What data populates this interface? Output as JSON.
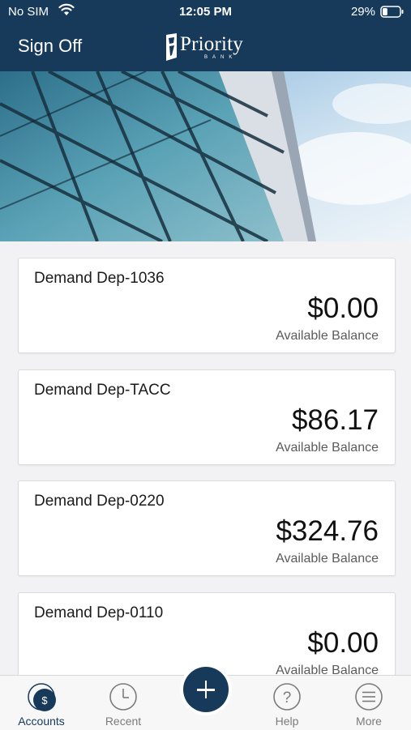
{
  "status_bar": {
    "carrier": "No SIM",
    "time": "12:05 PM",
    "battery_percent": "29%",
    "battery_level": 0.29
  },
  "header": {
    "sign_off_label": "Sign Off",
    "brand_name": "Priority",
    "brand_sub": "BANK",
    "background_color": "#173a5a"
  },
  "accounts": [
    {
      "name": "Demand Dep-1036",
      "balance": "$0.00",
      "balance_label": "Available Balance"
    },
    {
      "name": "Demand Dep-TACC",
      "balance": "$86.17",
      "balance_label": "Available Balance"
    },
    {
      "name": "Demand Dep-0220",
      "balance": "$324.76",
      "balance_label": "Available Balance"
    },
    {
      "name": "Demand Dep-0110",
      "balance": "$0.00",
      "balance_label": "Available Balance"
    }
  ],
  "tab_bar": {
    "accounts": {
      "label": "Accounts",
      "icon": "dollar-circle-icon",
      "active": true
    },
    "recent": {
      "label": "Recent",
      "icon": "clock-icon"
    },
    "add": {
      "icon": "plus-icon"
    },
    "help": {
      "label": "Help",
      "icon": "question-circle-icon"
    },
    "more": {
      "label": "More",
      "icon": "menu-circle-icon"
    }
  }
}
